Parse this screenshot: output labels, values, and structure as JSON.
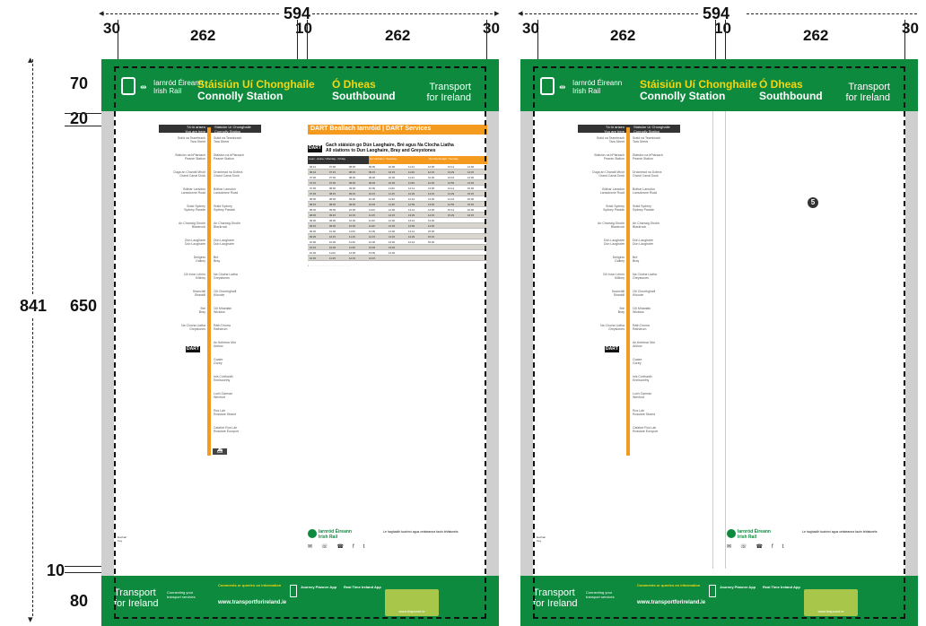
{
  "dimensions": {
    "left_width": "594",
    "right_width": "594",
    "margin_left": "30",
    "column_a": "262",
    "gutter": "10",
    "column_b": "262",
    "margin_right": "30",
    "total_height": "841",
    "header_height": "70",
    "gap_20": "20",
    "body_height": "650",
    "gap_10": "10",
    "footer_height": "80"
  },
  "header": {
    "rail_brand_ga": "Iarnród Éireann",
    "rail_brand_en": "Irish Rail",
    "station_ga": "Stáisiún Uí Chonghaile",
    "station_en": "Connolly Station",
    "direction_ga": "Ó Dheas",
    "direction_en": "Southbound",
    "tfi_line1": "Transport",
    "tfi_line2": "for Ireland"
  },
  "route_panel": {
    "you_are_here_ga": "Tá tú anseo",
    "you_are_here_en": "You are here",
    "station_ga": "Stáisiún Uí Chonghaile",
    "station_en": "Connolly Station",
    "dart_label": "DART",
    "right_stops": [
      "Sráid na Teamhrach",
      "Tara Street",
      "Stáisiún na bPiarsach",
      "Pearse Station",
      "Droichead na Dothra",
      "Grand Canal Dock",
      "Bóthar Lansdún",
      "Lansdowne Road",
      "Sráid Sydney",
      "Sydney Parade",
      "An Charraig Dhubh",
      "Blackrock",
      "Dún Laoghaire",
      "Dún Laoghaire",
      "Bré",
      "Bray",
      "Na Clocha Liatha",
      "Greystones",
      "Cill Chomhghaill",
      "Kilcoole",
      "Cill Mhantáin",
      "Wicklow",
      "Ráth Droma",
      "Rathdrum",
      "An tInbhear Mór",
      "Arklow",
      "Guaire",
      "Gorey",
      "Inis Córthaidh",
      "Enniscorthy",
      "Loch Garman",
      "Wexford",
      "Ros Láir",
      "Rosslare Strand",
      "Calafort Ros Láir",
      "Rosslare Europort"
    ],
    "left_stops": [
      "Sráid na Teamhrach",
      "Tara Street",
      "Stáisiún na bPiarsach",
      "Pearse Station",
      "Duga an Chanáil Mhóir",
      "Grand Canal Dock",
      "Bóthar Lansdún",
      "Lansdowne Road",
      "Sráid Sydney",
      "Sydney Parade",
      "An Charraig Dhubh",
      "Blackrock",
      "Dún Laoghaire",
      "Dún Laoghaire",
      "Deilginis",
      "Dalkey",
      "Cill Iníon Léinín",
      "Killiney",
      "Seanchill",
      "Shankill",
      "Bré",
      "Bray",
      "Na Clocha Liatha",
      "Greystones"
    ]
  },
  "timetable": {
    "title": "DART Beallach Iarnróid | DART Services",
    "sub_ga": "Gach stáisiún go Dún Laoghaire, Bré agus Na Clocha Liatha",
    "sub_en": "All stations to Dun Laoghaire, Bray and Greystones",
    "badge": "DART",
    "col_headers": [
      "Luan - Aoine / Monday - Friday",
      "Dé Sathairn / Saturday",
      "Dé Domhnaigh / Sunday"
    ],
    "rows": [
      [
        "06:14",
        "07:00",
        "08:00",
        "09:00",
        "10:00",
        "11:14",
        "12:00",
        "13:14",
        "14:00"
      ],
      [
        "06:44",
        "07:15",
        "08:15",
        "09:15",
        "10:15",
        "11:29",
        "12:15",
        "13:29",
        "14:15"
      ],
      [
        "07:00",
        "07:30",
        "08:30",
        "09:30",
        "10:30",
        "11:44",
        "12:30",
        "13:44",
        "14:30"
      ],
      [
        "07:15",
        "07:45",
        "08:45",
        "09:45",
        "10:45",
        "11:59",
        "12:45",
        "13:59",
        "14:45"
      ],
      [
        "07:30",
        "08:00",
        "09:00",
        "10:00",
        "11:00",
        "12:14",
        "13:00",
        "14:14",
        "15:00"
      ],
      [
        "07:45",
        "08:15",
        "09:15",
        "10:15",
        "11:15",
        "12:29",
        "13:15",
        "14:29",
        "15:15"
      ],
      [
        "08:00",
        "08:30",
        "09:30",
        "10:30",
        "11:30",
        "12:44",
        "13:30",
        "14:44",
        "15:30"
      ],
      [
        "08:15",
        "08:45",
        "09:45",
        "10:45",
        "11:45",
        "12:59",
        "13:45",
        "14:59",
        "15:45"
      ],
      [
        "08:30",
        "09:00",
        "10:00",
        "11:00",
        "12:00",
        "13:14",
        "14:00",
        "15:14",
        "16:00"
      ],
      [
        "08:45",
        "09:15",
        "10:15",
        "11:15",
        "12:15",
        "13:29",
        "14:15",
        "15:29",
        "16:15"
      ],
      [
        "09:00",
        "09:30",
        "10:30",
        "11:30",
        "12:30",
        "13:44",
        "14:30",
        "",
        ""
      ],
      [
        "09:15",
        "09:45",
        "10:45",
        "11:45",
        "12:45",
        "13:59",
        "14:45",
        "",
        ""
      ],
      [
        "09:30",
        "10:00",
        "11:00",
        "12:00",
        "13:00",
        "14:14",
        "15:00",
        "",
        ""
      ],
      [
        "09:45",
        "10:15",
        "11:15",
        "12:15",
        "13:15",
        "14:29",
        "15:15",
        "",
        ""
      ],
      [
        "10:00",
        "10:30",
        "11:30",
        "12:30",
        "13:30",
        "14:44",
        "15:30",
        "",
        ""
      ],
      [
        "10:15",
        "10:45",
        "11:45",
        "12:45",
        "13:45",
        "",
        "",
        "",
        ""
      ],
      [
        "10:30",
        "11:00",
        "12:00",
        "13:00",
        "14:00",
        "",
        "",
        "",
        ""
      ],
      [
        "10:45",
        "11:15",
        "12:15",
        "13:15",
        "",
        "",
        "",
        "",
        ""
      ]
    ]
  },
  "footer": {
    "connect_ga": "Connecting your",
    "connect_en": "transport services",
    "comments": "Comments or queries on information",
    "web": "www.transportforireland.ie",
    "journey_planner": "Journey Planner App",
    "real_time": "Real Time Ireland App",
    "card_label": "www.leapcard.ie"
  },
  "bottom_strip": {
    "brand_ga": "Iarnród Éireann",
    "brand_en": "Irish Rail",
    "note": "Le haghaidh tuairimí agus ceisteanna faoin bhfaisnéis"
  },
  "legend": {
    "key_ga": "Eochair",
    "key_en": "Key"
  },
  "right_poster": {
    "badge": "5"
  }
}
